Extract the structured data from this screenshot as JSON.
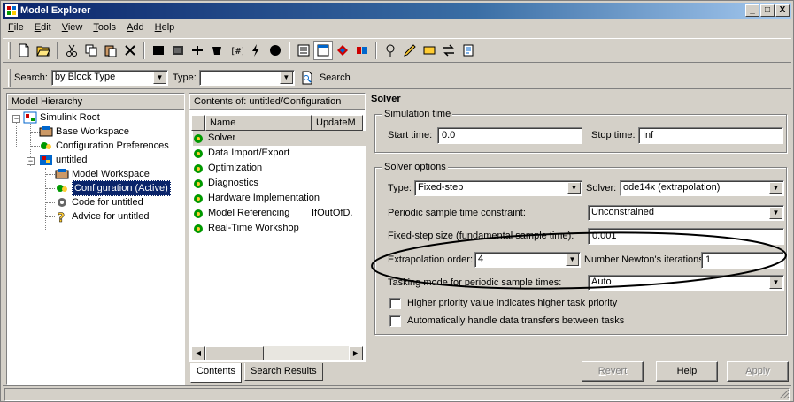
{
  "window": {
    "title": "Model Explorer",
    "controls": [
      "_",
      "□",
      "X"
    ]
  },
  "menubar": [
    {
      "label": "File",
      "mnemonic": "F",
      "rest": "ile"
    },
    {
      "label": "Edit",
      "mnemonic": "E",
      "rest": "dit"
    },
    {
      "label": "View",
      "mnemonic": "V",
      "rest": "iew"
    },
    {
      "label": "Tools",
      "mnemonic": "T",
      "rest": "ools"
    },
    {
      "label": "Add",
      "mnemonic": "A",
      "rest": "dd"
    },
    {
      "label": "Help",
      "mnemonic": "H",
      "rest": "elp"
    }
  ],
  "searchbar": {
    "search_label": "Search:",
    "search_by_value": "by Block Type",
    "type_label": "Type:",
    "type_value": "",
    "search_button": "Search"
  },
  "hierarchy": {
    "header": "Model Hierarchy",
    "items": {
      "root": "Simulink Root",
      "base_ws": "Base Workspace",
      "config_prefs": "Configuration Preferences",
      "untitled": "untitled",
      "model_ws": "Model Workspace",
      "config_active": "Configuration (Active)",
      "code": "Code for untitled",
      "advice": "Advice for untitled"
    }
  },
  "contents": {
    "header": "Contents of:  untitled/Configuration",
    "columns": {
      "name": "Name",
      "update": "UpdateM"
    },
    "rows": [
      {
        "name": "Solver",
        "update": ""
      },
      {
        "name": "Data Import/Export",
        "update": ""
      },
      {
        "name": "Optimization",
        "update": ""
      },
      {
        "name": "Diagnostics",
        "update": ""
      },
      {
        "name": "Hardware Implementation",
        "update": ""
      },
      {
        "name": "Model Referencing",
        "update": "IfOutOfD."
      },
      {
        "name": "Real-Time Workshop",
        "update": ""
      }
    ],
    "tabs": {
      "contents_m": "C",
      "contents_rest": "ontents",
      "search_m": "S",
      "search_rest": "earch Results"
    }
  },
  "solver": {
    "title": "Solver",
    "sim_time_group": "Simulation time",
    "start_time_label": "Start time:",
    "start_time_value": "0.0",
    "stop_time_label": "Stop time:",
    "stop_time_value": "Inf",
    "options_group": "Solver options",
    "type_label": "Type:",
    "type_value": "Fixed-step",
    "solver_label": "Solver:",
    "solver_value": "ode14x (extrapolation)",
    "periodic_label": "Periodic sample time constraint:",
    "periodic_value": "Unconstrained",
    "fixed_step_label": "Fixed-step size (fundamental sample time):",
    "fixed_step_value": "0.001",
    "extrap_label": "Extrapolation order:",
    "extrap_value": "4",
    "newton_label": "Number Newton's iterations:",
    "newton_value": "1",
    "tasking_label": "Tasking mode for periodic sample times:",
    "tasking_value": "Auto",
    "check1_label": "Higher priority value indicates higher task priority",
    "check1_checked": false,
    "check2_label": "Automatically handle data transfers between tasks",
    "check2_checked": false
  },
  "buttons": {
    "revert_m": "R",
    "revert_rest": "evert",
    "help_m": "H",
    "help_rest": "elp",
    "apply_m": "A",
    "apply_rest": "pply"
  },
  "colors": {
    "title_active": "#0a246a",
    "selection": "#0a246a",
    "face": "#d4d0c8"
  }
}
